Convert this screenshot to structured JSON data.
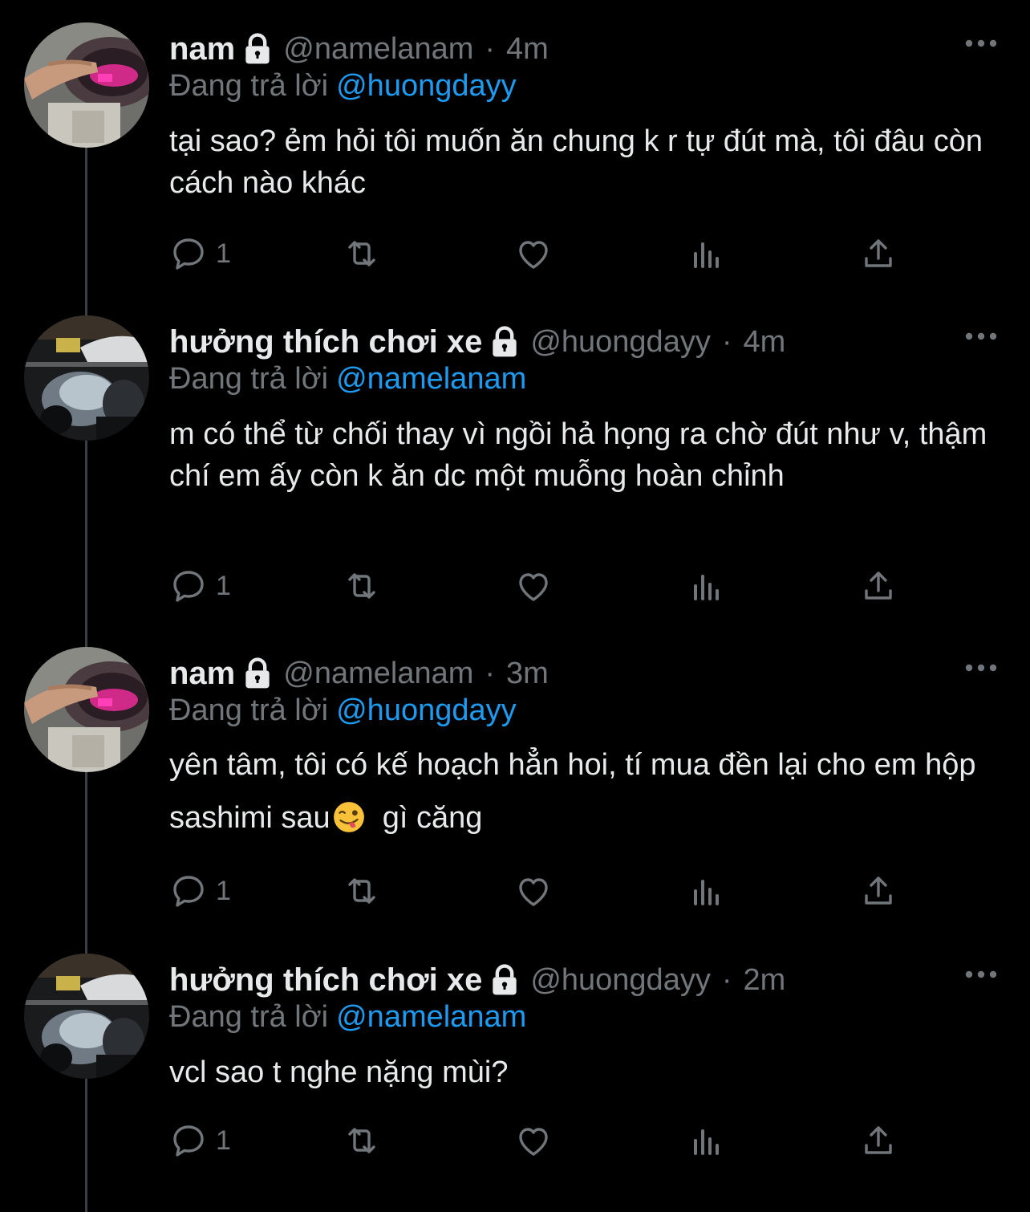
{
  "colors": {
    "background": "#000000",
    "text_primary": "#e7e9ea",
    "text_secondary": "#71767b",
    "link": "#1d9bf0",
    "thread_line": "#3b3f44"
  },
  "icons": {
    "lock": "lock-icon",
    "more": "more-horizontal-icon",
    "reply": "reply-bubble-icon",
    "retweet": "retweet-icon",
    "like": "heart-icon",
    "views": "analytics-bars-icon",
    "share": "share-upload-icon",
    "emoji": "winking-face-tongue-emoji"
  },
  "tweets": [
    {
      "display_name": "nam",
      "handle": "@namelanam",
      "separator": "·",
      "time": "4m",
      "reply_prefix": "Đang trả lời",
      "reply_to": "@huongdayy",
      "text": "tại sao? ẻm hỏi tôi muốn ăn chung k r tự đút mà, tôi đâu còn cách nào khác",
      "reply_count": "1"
    },
    {
      "display_name": "hưởng thích chơi xe",
      "handle": "@huongdayy",
      "separator": "·",
      "time": "4m",
      "reply_prefix": "Đang trả lời",
      "reply_to": "@namelanam",
      "text": "m có thể từ chối thay vì ngồi hả họng ra chờ đút như v, thậm chí em ấy còn k ăn dc một muỗng hoàn chỉnh",
      "reply_count": "1"
    },
    {
      "display_name": "nam",
      "handle": "@namelanam",
      "separator": "·",
      "time": "3m",
      "reply_prefix": "Đang trả lời",
      "reply_to": "@huongdayy",
      "text_before_emoji": "yên tâm, tôi có kế hoạch hẳn hoi, tí mua đền lại cho em hộp sashimi sau",
      "text_after_emoji": "  gì căng",
      "reply_count": "1"
    },
    {
      "display_name": "hưởng thích chơi xe",
      "handle": "@huongdayy",
      "separator": "·",
      "time": "2m",
      "reply_prefix": "Đang trả lời",
      "reply_to": "@namelanam",
      "text": "vcl sao t nghe nặng mùi?",
      "reply_count": "1"
    }
  ]
}
